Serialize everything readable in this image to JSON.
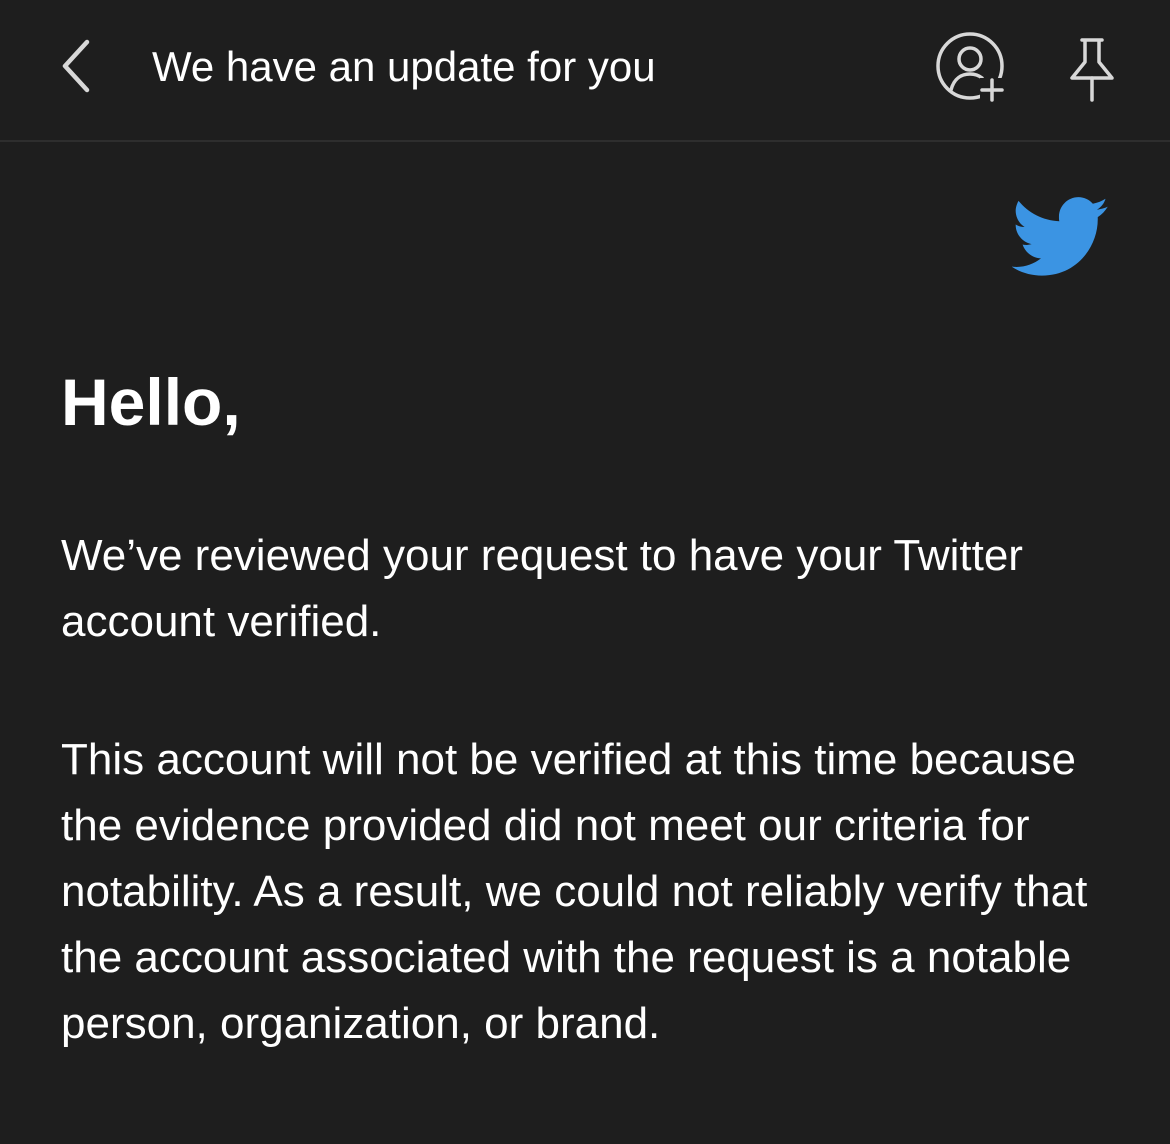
{
  "header": {
    "title": "We have an update for you",
    "back_icon": "chevron-left-icon",
    "add_contact_icon": "person-add-icon",
    "pin_icon": "pin-icon"
  },
  "email": {
    "logo_icon": "twitter-bird-icon",
    "greeting": "Hello,",
    "paragraphs": [
      "We’ve reviewed your request to have your Twitter account verified.",
      "This account will not be verified at this time because the evidence provided did not meet our criteria for notability. As a result, we could not reliably verify that the account associated with the request is a notable person, organization, or brand."
    ]
  },
  "colors": {
    "background": "#1e1e1e",
    "text": "#ffffff",
    "twitter_blue": "#3b94e3",
    "divider": "#2e2e2e"
  }
}
